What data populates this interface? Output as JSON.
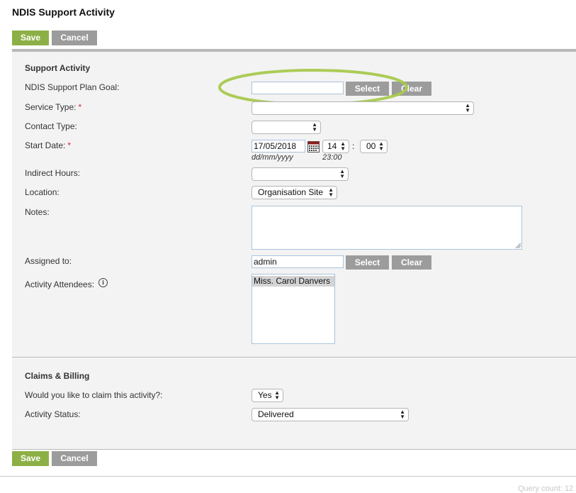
{
  "page": {
    "title": "NDIS Support Activity"
  },
  "actions": {
    "save_label": "Save",
    "cancel_label": "Cancel"
  },
  "support_activity": {
    "section_title": "Support Activity",
    "goal": {
      "label": "NDIS Support Plan Goal:",
      "value": "",
      "select_label": "Select",
      "clear_label": "Clear"
    },
    "service_type": {
      "label": "Service Type:",
      "required_mark": "*",
      "value": ""
    },
    "contact_type": {
      "label": "Contact Type:",
      "value": ""
    },
    "start_date": {
      "label": "Start Date:",
      "required_mark": "*",
      "date_value": "17/05/2018",
      "date_hint": "dd/mm/yyyy",
      "hour": "14",
      "minute": "00",
      "separator": ":",
      "time_hint": "23:00"
    },
    "indirect_hours": {
      "label": "Indirect Hours:",
      "value": ""
    },
    "location": {
      "label": "Location:",
      "value": "Organisation Site"
    },
    "notes": {
      "label": "Notes:",
      "value": ""
    },
    "assigned_to": {
      "label": "Assigned to:",
      "value": "admin",
      "select_label": "Select",
      "clear_label": "Clear"
    },
    "attendees": {
      "label": "Activity Attendees:",
      "info_glyph": "i",
      "items": [
        "Miss. Carol Danvers"
      ]
    }
  },
  "claims_billing": {
    "section_title": "Claims & Billing",
    "claim": {
      "label": "Would you like to claim this activity?:",
      "value": "Yes"
    },
    "status": {
      "label": "Activity Status:",
      "value": "Delivered"
    }
  },
  "footer": {
    "query_count": "Query count: 12"
  },
  "colors": {
    "save": "#8db046",
    "cancel": "#9c9c9c",
    "highlight": "#a8c94e",
    "required": "#d9262c"
  },
  "icons": {
    "calendar": "calendar-icon",
    "info": "info-icon"
  }
}
